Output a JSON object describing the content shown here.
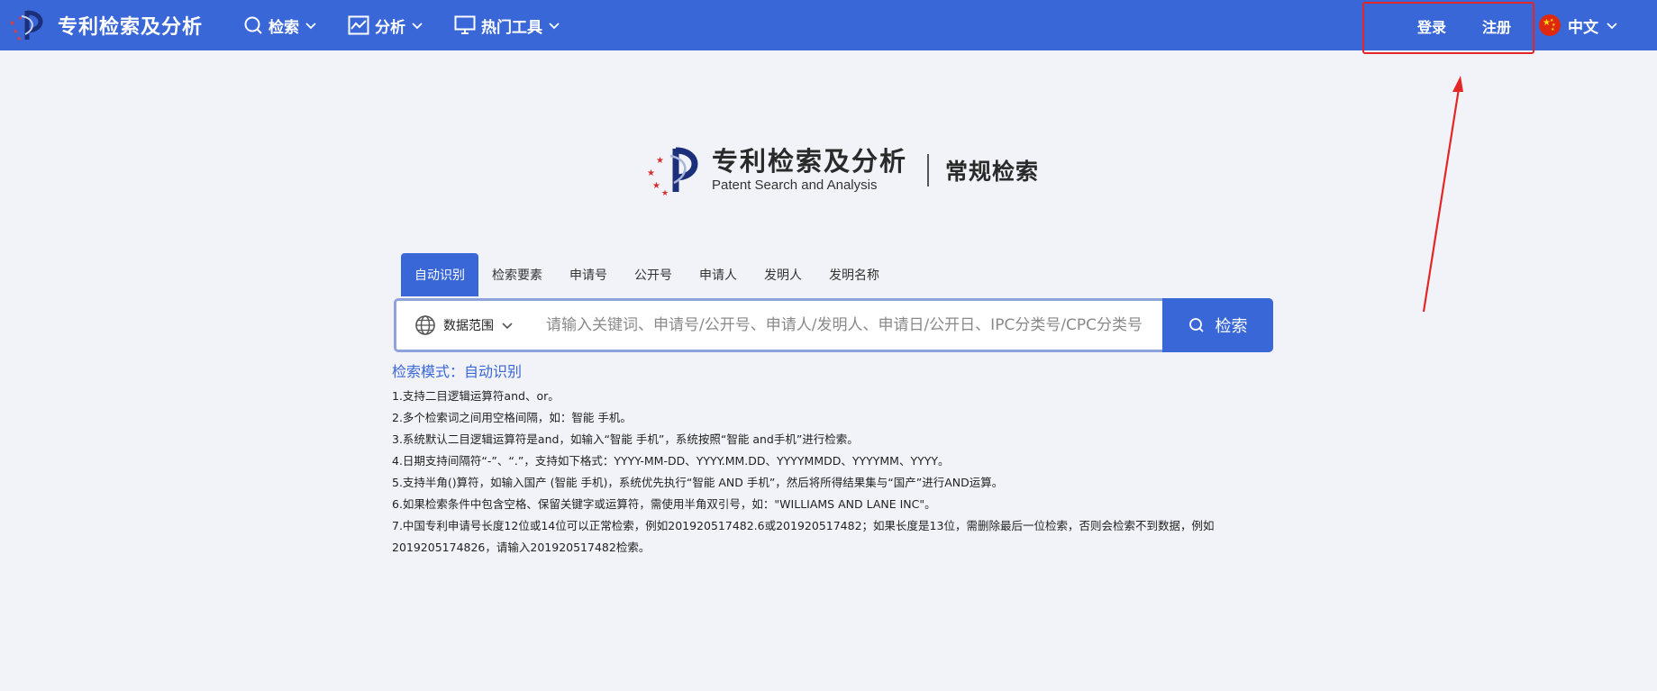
{
  "topbar": {
    "brand": "专利检索及分析",
    "nav": [
      {
        "label": "检索",
        "icon": "search-icon"
      },
      {
        "label": "分析",
        "icon": "chart-icon"
      },
      {
        "label": "热门工具",
        "icon": "monitor-icon"
      }
    ],
    "login": "登录",
    "register": "注册",
    "language": "中文"
  },
  "hero": {
    "title_cn": "专利检索及分析",
    "title_en": "Patent Search and Analysis",
    "mode": "常规检索"
  },
  "tabs": [
    "自动识别",
    "检索要素",
    "申请号",
    "公开号",
    "申请人",
    "发明人",
    "发明名称"
  ],
  "active_tab": "自动识别",
  "search": {
    "scope_label": "数据范围",
    "placeholder": "请输入关键词、申请号/公开号、申请人/发明人、申请日/公开日、IPC分类号/CPC分类号，...",
    "button_label": "检索"
  },
  "mode_line": "检索模式：自动识别",
  "help": [
    "1.支持二目逻辑运算符and、or。",
    "2.多个检索词之间用空格间隔，如：智能 手机。",
    "3.系统默认二目逻辑运算符是and，如输入“智能 手机”，系统按照“智能 and手机”进行检索。",
    "4.日期支持间隔符“-”、“.”，支持如下格式：YYYY-MM-DD、YYYY.MM.DD、YYYYMMDD、YYYYMM、YYYY。",
    "5.支持半角()算符，如输入国产 (智能 手机)，系统优先执行“智能 AND 手机”，然后将所得结果集与“国产”进行AND运算。",
    "6.如果检索条件中包含空格、保留关键字或运算符，需使用半角双引号，如：\"WILLIAMS AND LANE INC\"。",
    "7.中国专利申请号长度12位或14位可以正常检索，例如201920517482.6或201920517482；如果长度是13位，需删除最后一位检索，否则会检索不到数据，例如2019205174826，请输入201920517482检索。"
  ],
  "colors": {
    "primary": "#3a67d7",
    "annotation": "#e32626",
    "background": "#f2f3f8"
  }
}
